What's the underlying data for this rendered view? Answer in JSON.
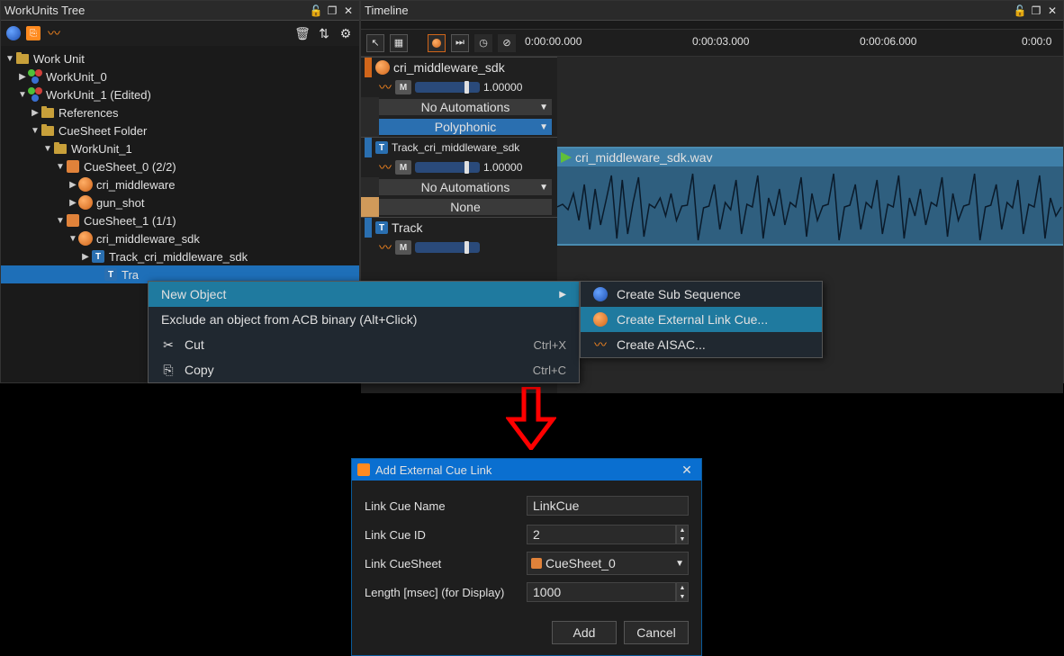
{
  "panels": {
    "left_title": "WorkUnits Tree",
    "right_title": "Timeline"
  },
  "tree": {
    "root": "Work Unit",
    "wu0": "WorkUnit_0",
    "wu1": "WorkUnit_1 (Edited)",
    "refs": "References",
    "folder": "CueSheet Folder",
    "wu1b": "WorkUnit_1",
    "cs0": "CueSheet_0 (2/2)",
    "cri": "cri_middleware",
    "gun": "gun_shot",
    "cs1": "CueSheet_1 (1/1)",
    "crisdk": "cri_middleware_sdk",
    "trackcri": "Track_cri_middleware_sdk",
    "tracksel": "Tra"
  },
  "timeline": {
    "t0": "0:00:00.000",
    "t3": "0:00:03.000",
    "t6": "0:00:06.000",
    "tEnd": "0:00:0",
    "track1_name": "cri_middleware_sdk",
    "value1": "1.00000",
    "noauto": "No Automations",
    "poly": "Polyphonic",
    "track2_name": "Track_cri_middleware_sdk",
    "value2": "1.00000",
    "none": "None",
    "track3_name": "Track",
    "clip_name": "cri_middleware_sdk.wav"
  },
  "menu1": {
    "new_obj": "New Object",
    "exclude": "Exclude an object from ACB binary (Alt+Click)",
    "cut": "Cut",
    "cut_sc": "Ctrl+X",
    "copy": "Copy",
    "copy_sc": "Ctrl+C"
  },
  "menu2": {
    "subseq": "Create Sub Sequence",
    "extlink": "Create External Link Cue...",
    "aisac": "Create AISAC..."
  },
  "dialog": {
    "title": "Add External Cue Link",
    "name_lbl": "Link Cue Name",
    "name_hint": "LinkCue",
    "id_lbl": "Link Cue ID",
    "id_val": "2",
    "sheet_lbl": "Link CueSheet",
    "sheet_val": "CueSheet_0",
    "len_lbl": "Length [msec] (for Display)",
    "len_val": "1000",
    "add": "Add",
    "cancel": "Cancel"
  }
}
